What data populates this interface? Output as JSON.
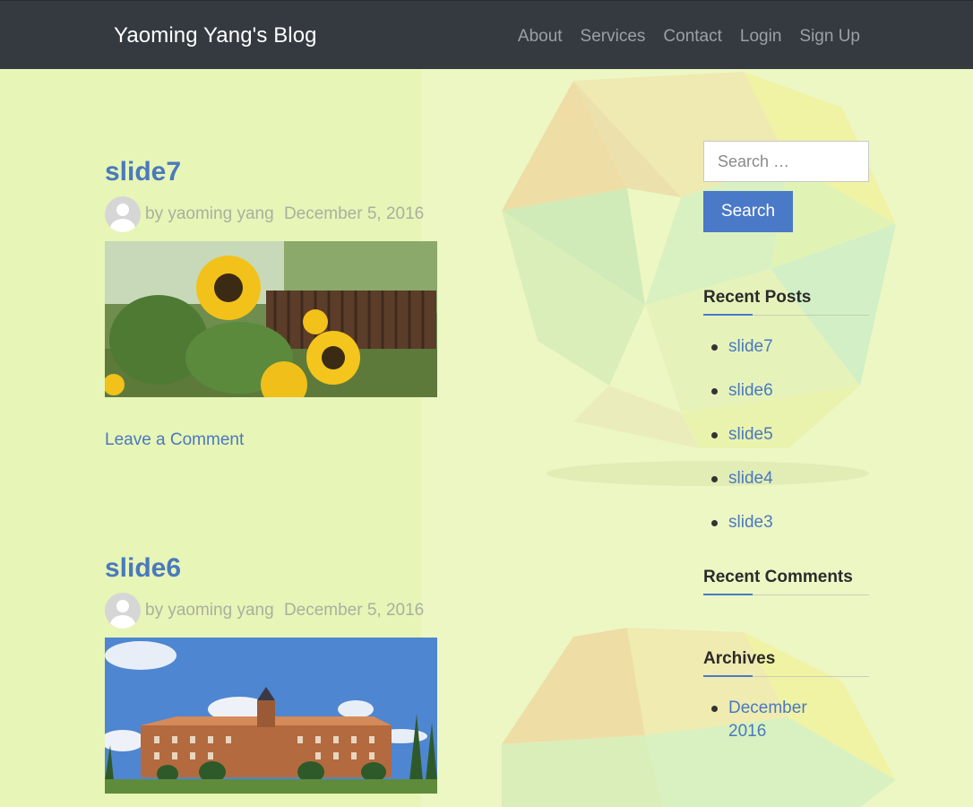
{
  "navbar": {
    "brand": "Yaoming Yang's Blog",
    "links": [
      "About",
      "Services",
      "Contact",
      "Login",
      "Sign Up"
    ]
  },
  "posts": [
    {
      "title": "slide7",
      "author": "by yaoming yang",
      "date": "December 5, 2016",
      "comment_link": "Leave a Comment"
    },
    {
      "title": "slide6",
      "author": "by yaoming yang",
      "date": "December 5, 2016"
    }
  ],
  "sidebar": {
    "search": {
      "placeholder": "Search …",
      "button": "Search"
    },
    "recent_posts": {
      "title": "Recent Posts",
      "items": [
        "slide7",
        "slide6",
        "slide5",
        "slide4",
        "slide3"
      ]
    },
    "recent_comments": {
      "title": "Recent Comments"
    },
    "archives": {
      "title": "Archives",
      "items": [
        "December 2016"
      ]
    }
  },
  "colors": {
    "nav_bg": "#343a40",
    "link": "#4a79bd",
    "button": "#4a79c8",
    "page_bg": "#e6f4b8"
  }
}
